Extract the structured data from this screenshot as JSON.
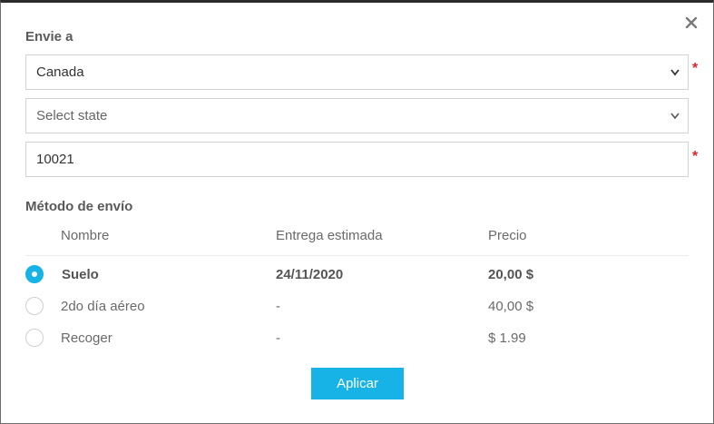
{
  "dialog": {
    "close_icon": "close-icon",
    "ship_to": {
      "title": "Envie a",
      "country_value": "Canada",
      "state_placeholder": "Select state",
      "postal_value": "10021",
      "required_mark": "*"
    },
    "shipping_method": {
      "title": "Método de envío",
      "columns": {
        "name": "Nombre",
        "estimate": "Entrega estimada",
        "price": "Precio"
      },
      "options": [
        {
          "name": "Suelo",
          "estimate": "24/11/2020",
          "price": "20,00 $",
          "selected": true
        },
        {
          "name": "2do día aéreo",
          "estimate": "-",
          "price": "40,00 $",
          "selected": false
        },
        {
          "name": "Recoger",
          "estimate": "-",
          "price": "$ 1.99",
          "selected": false
        }
      ]
    },
    "apply_label": "Aplicar"
  },
  "colors": {
    "accent": "#17b3e6",
    "required": "#e02424",
    "text": "#6a6a6a"
  }
}
